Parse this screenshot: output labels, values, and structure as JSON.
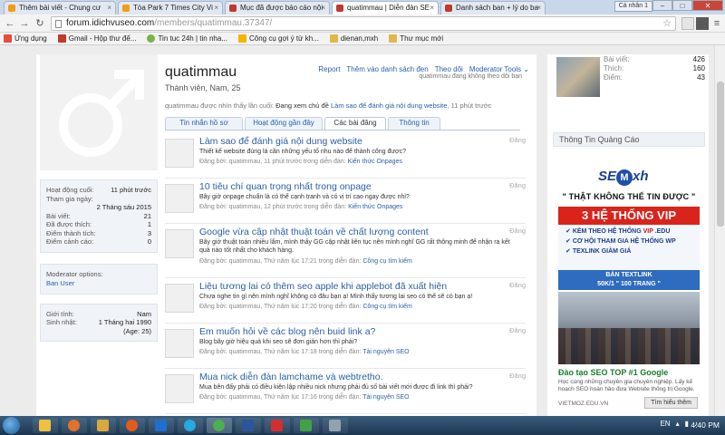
{
  "browser": {
    "tabs": [
      {
        "label": "Thêm bài viết - Chung cư",
        "fav_color": "#f39c12",
        "active": false
      },
      {
        "label": "Tòa Park 7 Times City Vi",
        "fav_color": "#f39c12",
        "active": false
      },
      {
        "label": "Mục đã được báo cáo nội",
        "fav_color": "#c0392b",
        "active": false
      },
      {
        "label": "quatimmau | Diễn đàn SE",
        "fav_color": "#c0392b",
        "active": true
      },
      {
        "label": "Danh sách ban + lý do ba",
        "fav_color": "#c0392b",
        "active": false
      }
    ],
    "user_badge": "Cá nhân 1",
    "url_domain": "forum.idichvuseo.com",
    "url_path": "/members/quatimmau.37347/",
    "bookmarks": [
      {
        "label": "Ứng dụng",
        "color": "#e74c3c"
      },
      {
        "label": "Gmail - Hộp thư đế...",
        "color": "#c0392b"
      },
      {
        "label": "Tin tuc 24h | tin nha...",
        "color": "#7cb342"
      },
      {
        "label": "Công cụ gợi ý từ kh...",
        "color": "#f5b400"
      },
      {
        "label": "dienan,mxh",
        "color": "#e0b84a"
      },
      {
        "label": "Thư mục mới",
        "color": "#e0b84a"
      }
    ]
  },
  "profile": {
    "name": "quatimmau",
    "title": "Thành viên, Nam, 25",
    "links": [
      "Report",
      "Thêm vào danh sách đen",
      "Theo dõi",
      "Moderator Tools"
    ],
    "follow_note": "quatimmau đang không theo dõi bạn",
    "seen_prefix": "quatimmau được nhìn thấy lần cuối:",
    "seen_action": "Đang xem chủ đề",
    "seen_link": "Làm sao để đánh giá nội dung website",
    "seen_time": ", 11 phút trước"
  },
  "info_box": [
    {
      "k": "Hoạt động cuối:",
      "v": "11 phút trước"
    },
    {
      "k": "Tham gia ngày:",
      "v": "2 Tháng sáu 2015"
    },
    {
      "k": "Bài viết:",
      "v": "21"
    },
    {
      "k": "Đã được thích:",
      "v": "1"
    },
    {
      "k": "Điểm thành tích:",
      "v": "3"
    },
    {
      "k": "Điểm cảnh cáo:",
      "v": "0"
    }
  ],
  "moderator": {
    "label": "Moderator options:",
    "link": "Ban User"
  },
  "personal": [
    {
      "k": "Giới tính:",
      "v": "Nam"
    },
    {
      "k": "Sinh nhật:",
      "v": "1 Tháng hai 1990"
    },
    {
      "k": "",
      "v": "(Age: 25)"
    }
  ],
  "profile_tabs": [
    {
      "label": "Tin nhắn hồ sơ",
      "active": false
    },
    {
      "label": "Hoạt động gần đây",
      "active": false
    },
    {
      "label": "Các bài đăng",
      "active": true
    },
    {
      "label": "Thông tin",
      "active": false
    }
  ],
  "posts": [
    {
      "title": "Làm sao để đánh giá nội dung website",
      "excerpt": "Thiết kế website đúng là cần những yếu tố nhu nào để thành công được?",
      "meta_prefix": "Đăng bởi: quatimmau, 11 phút trước trong diễn đàn:",
      "forum": "Kiến thức Onpages",
      "kind": "Đăng"
    },
    {
      "title": "10 tiêu chí quan trọng nhất trong onpage",
      "excerpt": "Bây giờ onpage chuẩn là có thể cạnh tranh và có vị trí cao ngay được nhỉ?",
      "meta_prefix": "Đăng bởi: quatimmau, 12 phút trước trong diễn đàn:",
      "forum": "Kiến thức Onpages",
      "kind": "Đăng"
    },
    {
      "title": "Google vừa cập nhật thuật toán về chất lượng content",
      "excerpt": "Bây giờ thuật toán nhiều lắm, mình thấy GG cập nhật liên tục nên mình nghĩ GG rất thông minh để nhận ra kết quả nào tốt nhất cho khách hàng.",
      "meta_prefix": "Đăng bởi: quatimmau, Thứ năm lúc 17:21 trong diễn đàn:",
      "forum": "Công cụ tìm kiếm",
      "kind": "Đăng"
    },
    {
      "title": "Liệu tương lai có thêm seo apple khi applebot đã xuất hiện",
      "excerpt": "Chưa nghe tin gì nên mình nghĩ không có đâu bạn ạ! Mình thấy tương lai seo có thể sẽ có bạn ạ!",
      "meta_prefix": "Đăng bởi: quatimmau, Thứ năm lúc 17:20 trong diễn đàn:",
      "forum": "Công cụ tìm kiếm",
      "kind": "Đăng"
    },
    {
      "title": "Em muốn hỏi về các blog nên buid link a?",
      "excerpt": "Blog bây giờ hiệu quả khi seo sẽ đơn giản hơn thì phải?",
      "meta_prefix": "Đăng bởi: quatimmau, Thứ năm lúc 17:18 trong diễn đàn:",
      "forum": "Tài nguyên SEO",
      "kind": "Đăng"
    },
    {
      "title": "Mua nick diễn đàn lamchame và webtretho.",
      "excerpt": "Mua bên đấy phải có điều kiện lập nhiều nick nhưng phải đủ số bài viết mới được đi link thì phải?",
      "meta_prefix": "Đăng bởi: quatimmau, Thứ năm lúc 17:16 trong diễn đàn:",
      "forum": "Tài nguyên SEO",
      "kind": "Đăng"
    }
  ],
  "right_stats": [
    {
      "k": "Bài viết:",
      "v": "426"
    },
    {
      "k": "Thích:",
      "v": "160"
    },
    {
      "k": "Điểm:",
      "v": "43"
    }
  ],
  "ad": {
    "heading": "Thông Tin Quảng Cáo",
    "logo_pre": "SE",
    "logo_m": "M",
    "logo_post": "xh",
    "slogan": "\" THẬT KHÔNG THỂ TIN ĐƯỢC \"",
    "banner": "3 HỆ THỐNG VIP",
    "list": [
      {
        "pre": "KÈM THEO HỆ THỐNG ",
        "hl": "VIP",
        "post": " .EDU"
      },
      {
        "pre": "CƠ HỘI THAM GIA HỆ THỐNG WP",
        "hl": "",
        "post": ""
      },
      {
        "pre": "TEXLINK GIẢM GIÁ",
        "hl": "",
        "post": ""
      }
    ],
    "textlink_1": "BÁN TEXTLINK",
    "textlink_2": "50K/1 \" 100 TRANG \"",
    "title2": "Đào tạo SEO TOP #1 Google",
    "desc": "Học cùng những chuyên gia chuyên nghiệp. Lấy kế hoạch SEO hoàn hảo đưa Website thống trị Google.",
    "url": "VIETMOZ.EDU.VN",
    "button": "Tìm hiểu thêm"
  },
  "taskbar": {
    "lang": "EN",
    "time": "4:40 PM"
  }
}
